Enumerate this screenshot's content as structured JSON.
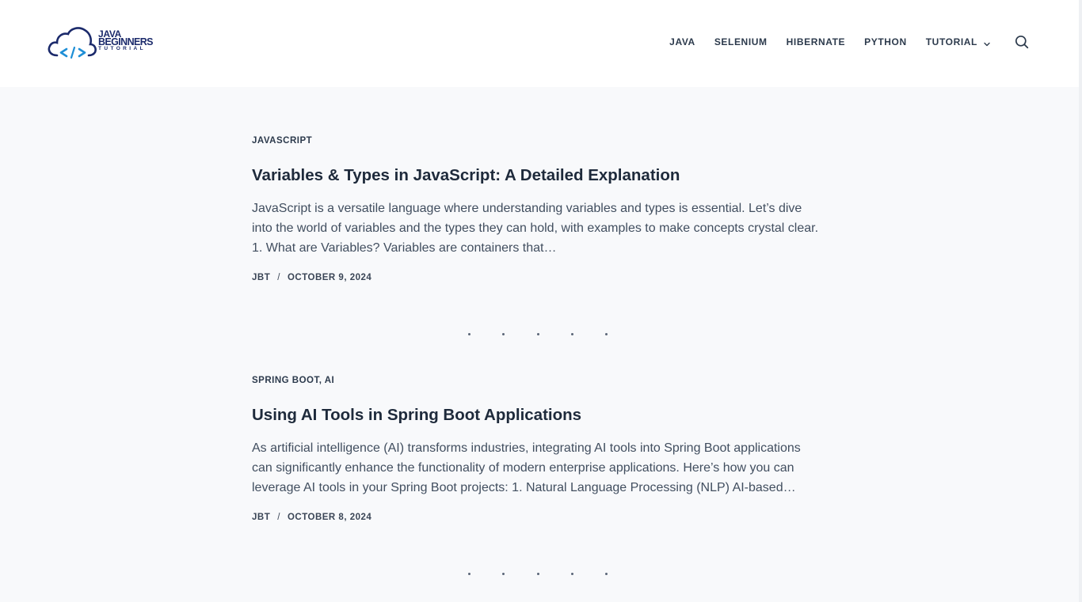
{
  "header": {
    "logo": {
      "line1": "JAVA",
      "line2": "BEGINNERS",
      "line3": "TUTORIAL",
      "brand_color": "#1b2a6b",
      "accent_color": "#1f8fd6"
    },
    "nav": [
      {
        "label": "JAVA"
      },
      {
        "label": "SELENIUM"
      },
      {
        "label": "HIBERNATE"
      },
      {
        "label": "PYTHON"
      },
      {
        "label": "TUTORIAL",
        "icon": "chevron-down-icon"
      }
    ],
    "search_icon": "search-icon"
  },
  "posts": [
    {
      "category": "JAVASCRIPT",
      "title": "Variables & Types in JavaScript: A Detailed Explanation",
      "excerpt": "JavaScript is a versatile language where understanding variables and types is essential. Let’s dive into the world of variables and the types they can hold, with examples to make concepts crystal clear. 1. What are Variables? Variables are containers that…",
      "author": "JBT",
      "separator": "/",
      "date": "OCTOBER 9, 2024"
    },
    {
      "category": "SPRING BOOT, AI",
      "title": "Using AI Tools in Spring Boot Applications",
      "excerpt": "As artificial intelligence (AI) transforms industries, integrating AI tools into Spring Boot applications can significantly enhance the functionality of modern enterprise applications. Here’s how you can leverage AI tools in your Spring Boot projects: 1. Natural Language Processing (NLP) AI-based…",
      "author": "JBT",
      "separator": "/",
      "date": "OCTOBER 8, 2024"
    }
  ]
}
